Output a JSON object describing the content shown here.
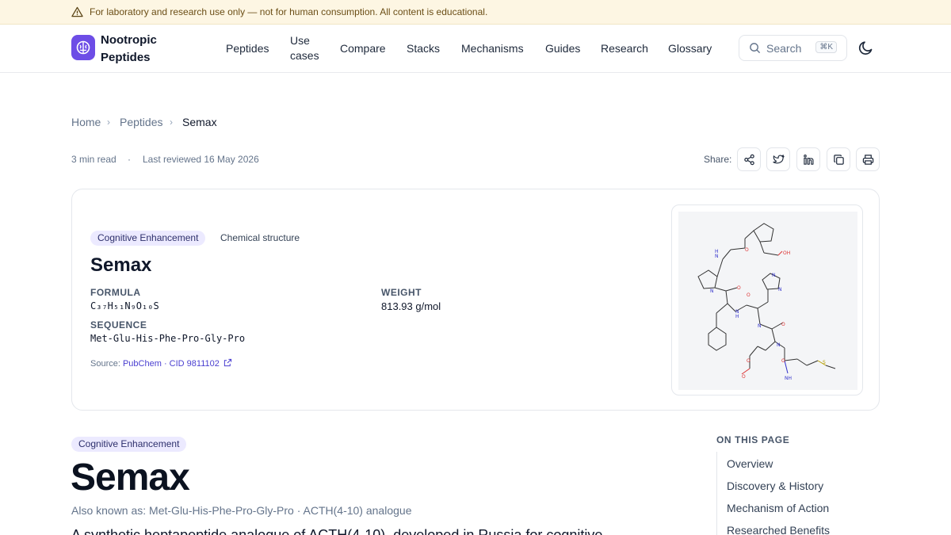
{
  "banner": {
    "text": "For laboratory and research use only — not for human consumption. All content is educational.",
    "icon": "warning-triangle-icon"
  },
  "header": {
    "brand_line1": "Nootropic",
    "brand_line2": "Peptides",
    "brand_color": "#6d4de6",
    "nav": [
      "Peptides",
      "Use",
      "cases",
      "Compare",
      "Stacks",
      "Mechanisms",
      "Guides",
      "Research",
      "Glossary"
    ],
    "search_label": "Search",
    "search_shortcut": "⌘K"
  },
  "breadcrumb": [
    "Home",
    "Peptides",
    "Semax"
  ],
  "meta": {
    "read_time": "3 min read",
    "dot": "·",
    "reviewed": "Last reviewed 16 May 2026"
  },
  "share": {
    "label": "Share:",
    "buttons": [
      "share-icon",
      "twitter-icon",
      "linkedin-icon",
      "copy-icon",
      "print-icon"
    ]
  },
  "card": {
    "category": "Cognitive Enhancement",
    "tag": "Chemical structure",
    "title": "Semax",
    "formula_label": "FORMULA",
    "formula": "C₃₇H₅₁N₉O₁₀S",
    "weight_label": "WEIGHT",
    "weight": "813.93 g/mol",
    "sequence_label": "SEQUENCE",
    "sequence": "Met-Glu-His-Phe-Pro-Gly-Pro",
    "source_prefix": "Source: ",
    "source_link": "PubChem · CID 9811102"
  },
  "article": {
    "category": "Cognitive Enhancement",
    "title": "Semax",
    "aka": "Also known as: Met-Glu-His-Phe-Pro-Gly-Pro · ACTH(4-10) analogue",
    "lead": "A synthetic heptapeptide analogue of ACTH(4-10), developed in Russia for cognitive"
  },
  "toc": {
    "heading": "ON THIS PAGE",
    "items": [
      "Overview",
      "Discovery & History",
      "Mechanism of Action",
      "Researched Benefits"
    ]
  }
}
